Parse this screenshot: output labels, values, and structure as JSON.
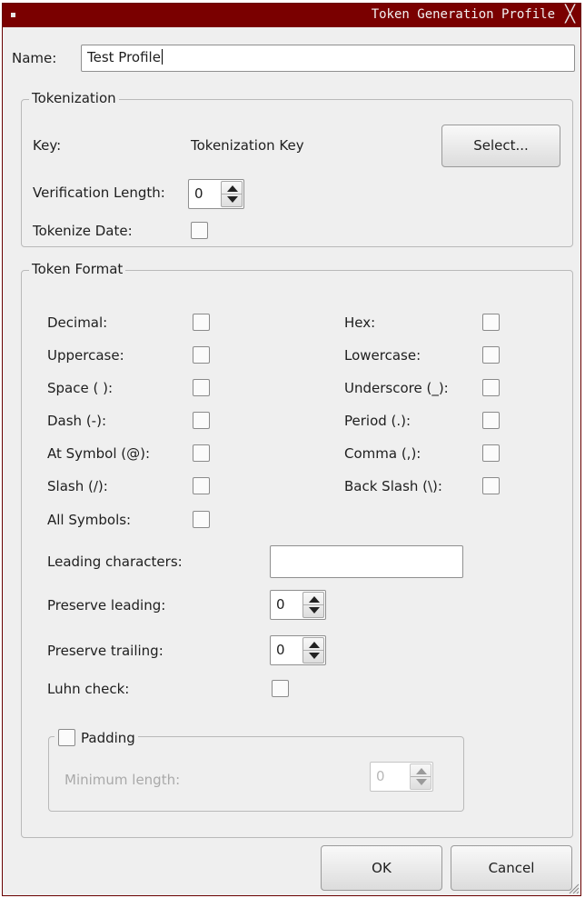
{
  "window": {
    "title": "Token Generation Profile",
    "close_glyph": "╳"
  },
  "name": {
    "label": "Name:",
    "value": "Test Profile"
  },
  "tokenization": {
    "title": "Tokenization",
    "key_label": "Key:",
    "key_value": "Tokenization Key",
    "select_label": "Select...",
    "verification_label": "Verification Length:",
    "verification_value": "0",
    "tokenize_date_label": "Tokenize Date:",
    "tokenize_date_checked": false
  },
  "token_format": {
    "title": "Token Format",
    "left_options": [
      {
        "label": "Decimal:",
        "checked": false
      },
      {
        "label": "Uppercase:",
        "checked": false
      },
      {
        "label": "Space ( ):",
        "checked": false
      },
      {
        "label": "Dash (-):",
        "checked": false
      },
      {
        "label": "At Symbol (@):",
        "checked": false
      },
      {
        "label": "Slash (/):",
        "checked": false
      },
      {
        "label": "All Symbols:",
        "checked": false
      }
    ],
    "right_options": [
      {
        "label": "Hex:",
        "checked": false
      },
      {
        "label": "Lowercase:",
        "checked": false
      },
      {
        "label": "Underscore (_):",
        "checked": false
      },
      {
        "label": "Period (.):",
        "checked": false
      },
      {
        "label": "Comma (,):",
        "checked": false
      },
      {
        "label": "Back Slash (\\):",
        "checked": false
      }
    ],
    "leading_chars_label": "Leading characters:",
    "leading_chars_value": "",
    "preserve_leading_label": "Preserve leading:",
    "preserve_leading_value": "0",
    "preserve_trailing_label": "Preserve trailing:",
    "preserve_trailing_value": "0",
    "luhn_label": "Luhn check:",
    "luhn_checked": false,
    "padding": {
      "title": "Padding",
      "checked": false,
      "min_length_label": "Minimum length:",
      "min_length_value": "0"
    }
  },
  "buttons": {
    "ok": "OK",
    "cancel": "Cancel"
  },
  "colors": {
    "titlebar": "#7a0000",
    "window_bg": "#efefef"
  }
}
